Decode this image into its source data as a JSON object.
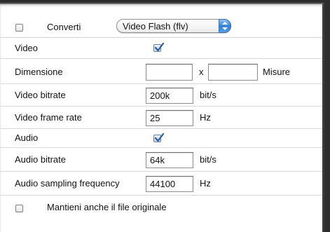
{
  "convert": {
    "checked": false,
    "label": "Converti",
    "format_selected": "Video Flash (flv)"
  },
  "video": {
    "label": "Video",
    "checked": true
  },
  "dimension": {
    "label": "Dimensione",
    "width_value": "",
    "separator": "x",
    "height_value": "",
    "unit": "Misure"
  },
  "video_bitrate": {
    "label": "Video bitrate",
    "value": "200k",
    "unit": "bit/s"
  },
  "video_frame_rate": {
    "label": "Video frame rate",
    "value": "25",
    "unit": "Hz"
  },
  "audio": {
    "label": "Audio",
    "checked": true
  },
  "audio_bitrate": {
    "label": "Audio bitrate",
    "value": "64k",
    "unit": "bit/s"
  },
  "audio_sampling": {
    "label": "Audio sampling frequency",
    "value": "44100",
    "unit": "Hz"
  },
  "keep_original": {
    "checked": false,
    "label": "Mantieni anche il file originale"
  },
  "colors": {
    "checkbox_checked": "#2b5c9e",
    "stepper_accent": "#2f7fd9"
  },
  "icons": {
    "checkbox_unchecked": "checkbox-empty-icon",
    "checkbox_checked": "checkmark-icon",
    "select_stepper": "up-down-arrows-icon"
  }
}
